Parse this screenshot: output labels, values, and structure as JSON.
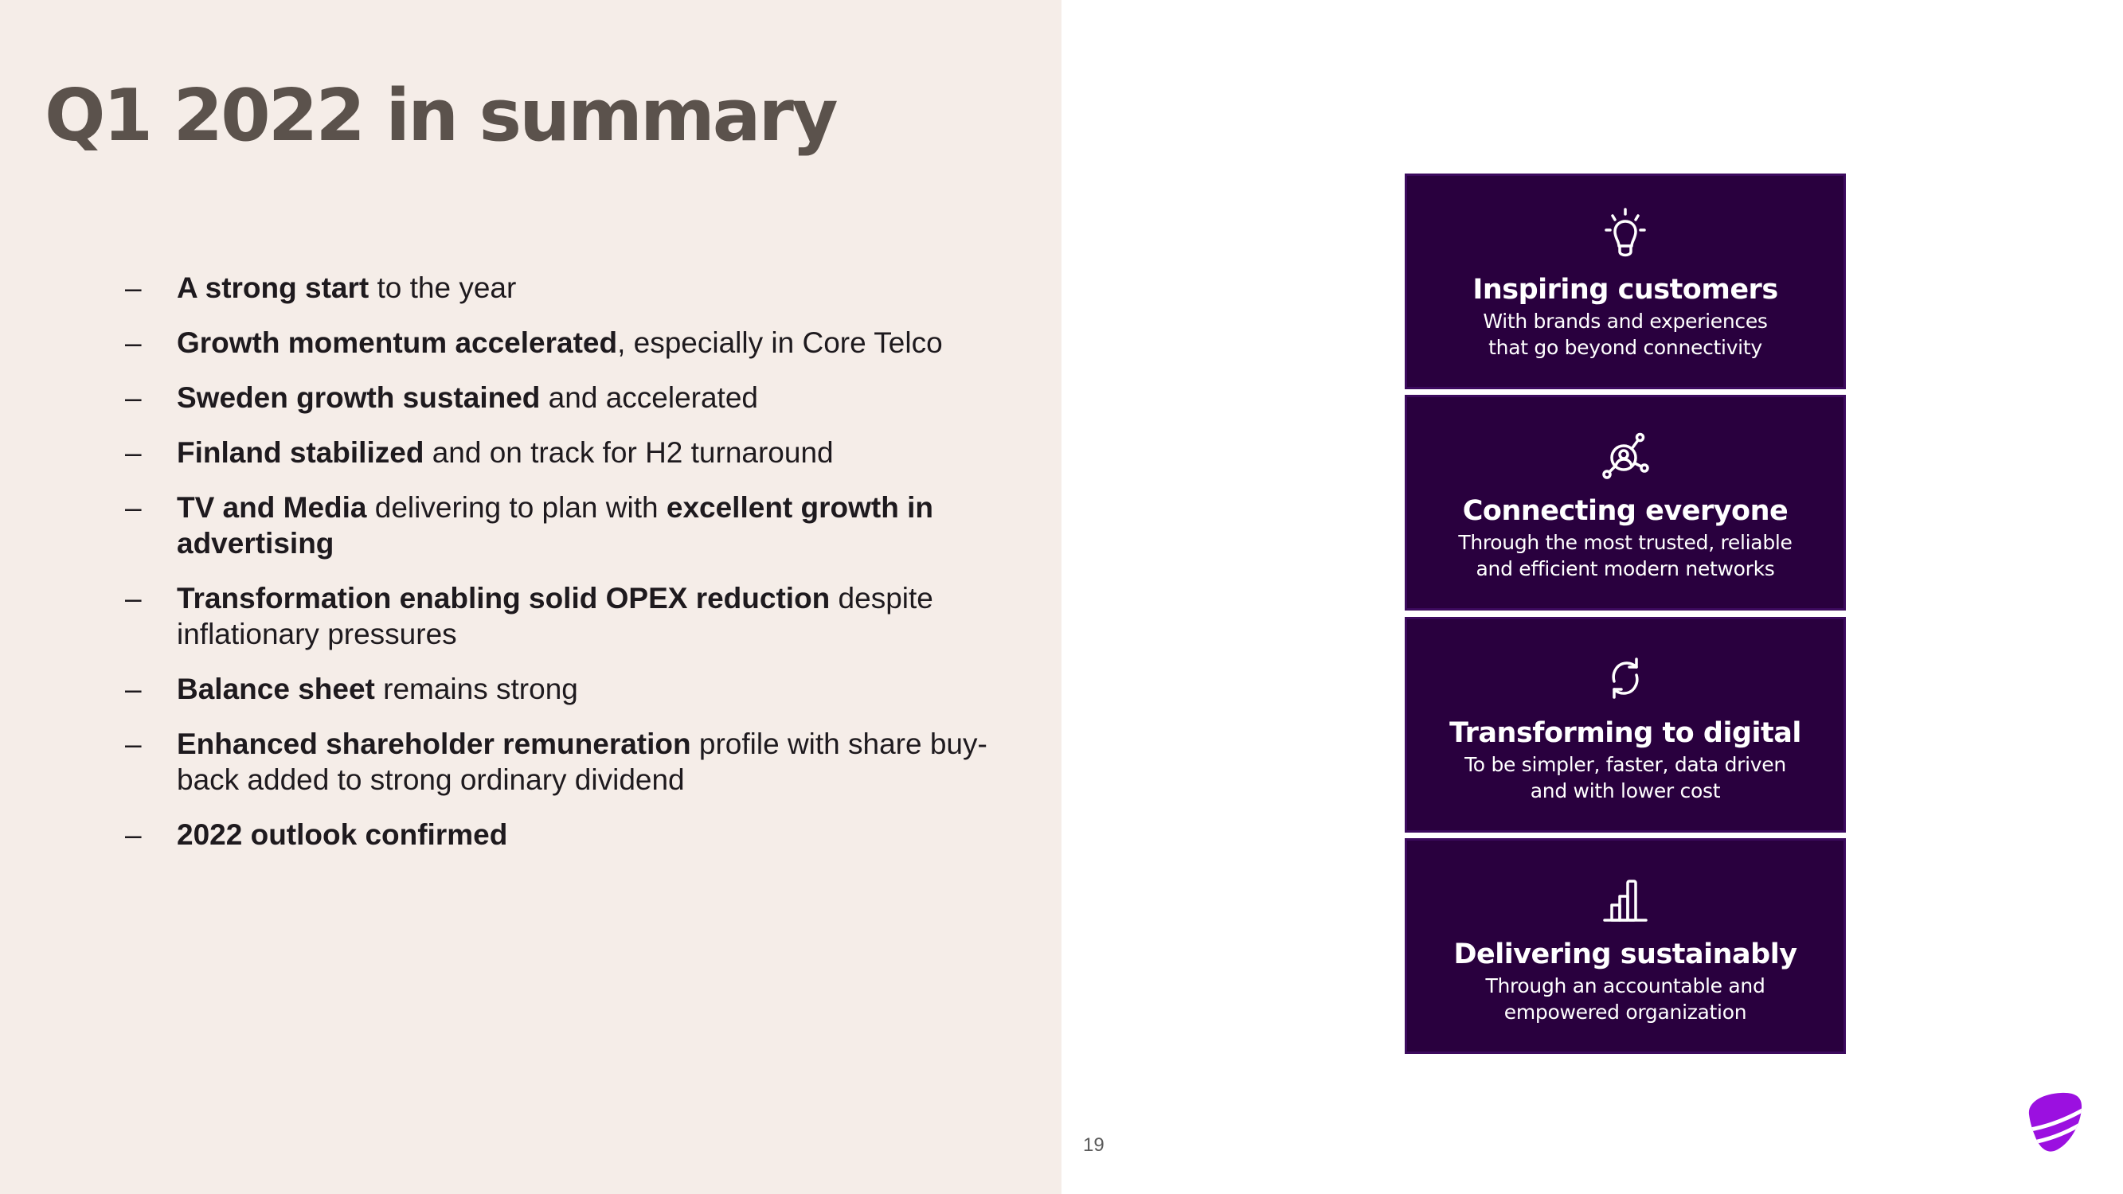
{
  "slide": {
    "title": "Q1 2022 in summary",
    "page_number": "19",
    "colors": {
      "left_panel_bg": "#F5EDE8",
      "title": "#5B524C",
      "body_text": "#1E1A1E",
      "card_bg": "#29003E",
      "card_border": "#3C0A5E",
      "card_text": "#FFFFFF",
      "brand_purple": "#9B10E0"
    },
    "bullet_marker": "–",
    "bullets": [
      {
        "segments": [
          {
            "text": "A strong start",
            "bold": true
          },
          {
            "text": " to the year",
            "bold": false
          }
        ]
      },
      {
        "segments": [
          {
            "text": "Growth momentum accelerated",
            "bold": true
          },
          {
            "text": ", especially in Core Telco",
            "bold": false
          }
        ]
      },
      {
        "segments": [
          {
            "text": "Sweden growth sustained",
            "bold": true
          },
          {
            "text": " and accelerated",
            "bold": false
          }
        ]
      },
      {
        "segments": [
          {
            "text": "Finland stabilized",
            "bold": true
          },
          {
            "text": " and on track for H2 turnaround",
            "bold": false
          }
        ]
      },
      {
        "segments": [
          {
            "text": "TV and Media",
            "bold": true
          },
          {
            "text": " delivering to plan with ",
            "bold": false
          },
          {
            "text": "excellent growth in advertising",
            "bold": true
          }
        ]
      },
      {
        "segments": [
          {
            "text": "Transformation enabling solid OPEX reduction",
            "bold": true
          },
          {
            "text": " despite inflationary pressures",
            "bold": false
          }
        ]
      },
      {
        "segments": [
          {
            "text": "Balance sheet",
            "bold": true
          },
          {
            "text": " remains strong",
            "bold": false
          }
        ]
      },
      {
        "segments": [
          {
            "text": "Enhanced shareholder remuneration",
            "bold": true
          },
          {
            "text": " profile with share buy-back added to strong ordinary dividend",
            "bold": false
          }
        ]
      },
      {
        "segments": [
          {
            "text": "2022 outlook confirmed",
            "bold": true
          }
        ]
      }
    ],
    "cards": [
      {
        "icon": "lightbulb-icon",
        "title": "Inspiring customers",
        "lines": [
          "With brands and experiences",
          "that go beyond connectivity"
        ]
      },
      {
        "icon": "network-person-icon",
        "title": "Connecting everyone",
        "lines": [
          "Through the most trusted, reliable",
          "and efficient modern networks"
        ]
      },
      {
        "icon": "refresh-icon",
        "title": "Transforming to digital",
        "lines": [
          "To be simpler, faster, data driven",
          "and with lower cost"
        ]
      },
      {
        "icon": "bar-chart-icon",
        "title": "Delivering sustainably",
        "lines": [
          "Through an accountable and",
          "empowered organization"
        ]
      }
    ],
    "logo": "telia-logo-icon"
  }
}
